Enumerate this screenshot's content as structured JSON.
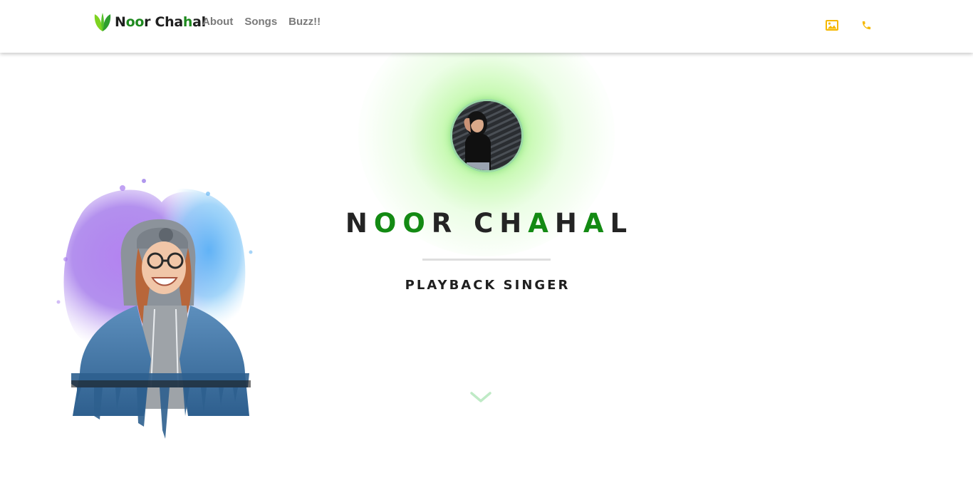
{
  "navbar": {
    "brand": {
      "name_part1": "N",
      "name_part2": "oo",
      "name_part3": "r Cha",
      "name_part4": "h",
      "name_part5": "al",
      "logo_icon": "leaf-icon"
    },
    "links": [
      {
        "label": "About"
      },
      {
        "label": "Songs"
      },
      {
        "label": "Buzz!!"
      }
    ],
    "icons": [
      {
        "name": "image-icon"
      },
      {
        "name": "phone-icon"
      }
    ]
  },
  "hero": {
    "title_segments": [
      "N",
      "OO",
      "R CH",
      "A",
      "H",
      "A",
      "L"
    ],
    "subtitle": "PLAYBACK SINGER",
    "scroll_icon": "chevron-down-icon"
  },
  "colors": {
    "accent_green": "#138a13",
    "icon_yellow": "#f5b800",
    "glow_green": "#78f050"
  }
}
